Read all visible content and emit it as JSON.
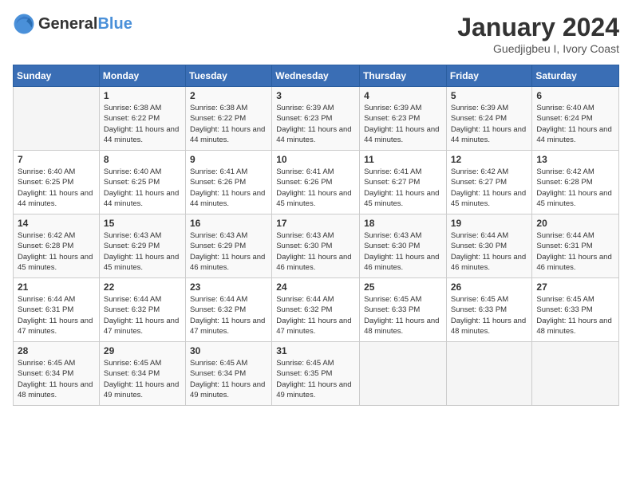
{
  "header": {
    "logo_general": "General",
    "logo_blue": "Blue",
    "month_year": "January 2024",
    "location": "Guedjigbeu I, Ivory Coast"
  },
  "weekdays": [
    "Sunday",
    "Monday",
    "Tuesday",
    "Wednesday",
    "Thursday",
    "Friday",
    "Saturday"
  ],
  "weeks": [
    [
      {
        "day": "",
        "sunrise": "",
        "sunset": "",
        "daylight": ""
      },
      {
        "day": "1",
        "sunrise": "Sunrise: 6:38 AM",
        "sunset": "Sunset: 6:22 PM",
        "daylight": "Daylight: 11 hours and 44 minutes."
      },
      {
        "day": "2",
        "sunrise": "Sunrise: 6:38 AM",
        "sunset": "Sunset: 6:22 PM",
        "daylight": "Daylight: 11 hours and 44 minutes."
      },
      {
        "day": "3",
        "sunrise": "Sunrise: 6:39 AM",
        "sunset": "Sunset: 6:23 PM",
        "daylight": "Daylight: 11 hours and 44 minutes."
      },
      {
        "day": "4",
        "sunrise": "Sunrise: 6:39 AM",
        "sunset": "Sunset: 6:23 PM",
        "daylight": "Daylight: 11 hours and 44 minutes."
      },
      {
        "day": "5",
        "sunrise": "Sunrise: 6:39 AM",
        "sunset": "Sunset: 6:24 PM",
        "daylight": "Daylight: 11 hours and 44 minutes."
      },
      {
        "day": "6",
        "sunrise": "Sunrise: 6:40 AM",
        "sunset": "Sunset: 6:24 PM",
        "daylight": "Daylight: 11 hours and 44 minutes."
      }
    ],
    [
      {
        "day": "7",
        "sunrise": "Sunrise: 6:40 AM",
        "sunset": "Sunset: 6:25 PM",
        "daylight": "Daylight: 11 hours and 44 minutes."
      },
      {
        "day": "8",
        "sunrise": "Sunrise: 6:40 AM",
        "sunset": "Sunset: 6:25 PM",
        "daylight": "Daylight: 11 hours and 44 minutes."
      },
      {
        "day": "9",
        "sunrise": "Sunrise: 6:41 AM",
        "sunset": "Sunset: 6:26 PM",
        "daylight": "Daylight: 11 hours and 44 minutes."
      },
      {
        "day": "10",
        "sunrise": "Sunrise: 6:41 AM",
        "sunset": "Sunset: 6:26 PM",
        "daylight": "Daylight: 11 hours and 45 minutes."
      },
      {
        "day": "11",
        "sunrise": "Sunrise: 6:41 AM",
        "sunset": "Sunset: 6:27 PM",
        "daylight": "Daylight: 11 hours and 45 minutes."
      },
      {
        "day": "12",
        "sunrise": "Sunrise: 6:42 AM",
        "sunset": "Sunset: 6:27 PM",
        "daylight": "Daylight: 11 hours and 45 minutes."
      },
      {
        "day": "13",
        "sunrise": "Sunrise: 6:42 AM",
        "sunset": "Sunset: 6:28 PM",
        "daylight": "Daylight: 11 hours and 45 minutes."
      }
    ],
    [
      {
        "day": "14",
        "sunrise": "Sunrise: 6:42 AM",
        "sunset": "Sunset: 6:28 PM",
        "daylight": "Daylight: 11 hours and 45 minutes."
      },
      {
        "day": "15",
        "sunrise": "Sunrise: 6:43 AM",
        "sunset": "Sunset: 6:29 PM",
        "daylight": "Daylight: 11 hours and 45 minutes."
      },
      {
        "day": "16",
        "sunrise": "Sunrise: 6:43 AM",
        "sunset": "Sunset: 6:29 PM",
        "daylight": "Daylight: 11 hours and 46 minutes."
      },
      {
        "day": "17",
        "sunrise": "Sunrise: 6:43 AM",
        "sunset": "Sunset: 6:30 PM",
        "daylight": "Daylight: 11 hours and 46 minutes."
      },
      {
        "day": "18",
        "sunrise": "Sunrise: 6:43 AM",
        "sunset": "Sunset: 6:30 PM",
        "daylight": "Daylight: 11 hours and 46 minutes."
      },
      {
        "day": "19",
        "sunrise": "Sunrise: 6:44 AM",
        "sunset": "Sunset: 6:30 PM",
        "daylight": "Daylight: 11 hours and 46 minutes."
      },
      {
        "day": "20",
        "sunrise": "Sunrise: 6:44 AM",
        "sunset": "Sunset: 6:31 PM",
        "daylight": "Daylight: 11 hours and 46 minutes."
      }
    ],
    [
      {
        "day": "21",
        "sunrise": "Sunrise: 6:44 AM",
        "sunset": "Sunset: 6:31 PM",
        "daylight": "Daylight: 11 hours and 47 minutes."
      },
      {
        "day": "22",
        "sunrise": "Sunrise: 6:44 AM",
        "sunset": "Sunset: 6:32 PM",
        "daylight": "Daylight: 11 hours and 47 minutes."
      },
      {
        "day": "23",
        "sunrise": "Sunrise: 6:44 AM",
        "sunset": "Sunset: 6:32 PM",
        "daylight": "Daylight: 11 hours and 47 minutes."
      },
      {
        "day": "24",
        "sunrise": "Sunrise: 6:44 AM",
        "sunset": "Sunset: 6:32 PM",
        "daylight": "Daylight: 11 hours and 47 minutes."
      },
      {
        "day": "25",
        "sunrise": "Sunrise: 6:45 AM",
        "sunset": "Sunset: 6:33 PM",
        "daylight": "Daylight: 11 hours and 48 minutes."
      },
      {
        "day": "26",
        "sunrise": "Sunrise: 6:45 AM",
        "sunset": "Sunset: 6:33 PM",
        "daylight": "Daylight: 11 hours and 48 minutes."
      },
      {
        "day": "27",
        "sunrise": "Sunrise: 6:45 AM",
        "sunset": "Sunset: 6:33 PM",
        "daylight": "Daylight: 11 hours and 48 minutes."
      }
    ],
    [
      {
        "day": "28",
        "sunrise": "Sunrise: 6:45 AM",
        "sunset": "Sunset: 6:34 PM",
        "daylight": "Daylight: 11 hours and 48 minutes."
      },
      {
        "day": "29",
        "sunrise": "Sunrise: 6:45 AM",
        "sunset": "Sunset: 6:34 PM",
        "daylight": "Daylight: 11 hours and 49 minutes."
      },
      {
        "day": "30",
        "sunrise": "Sunrise: 6:45 AM",
        "sunset": "Sunset: 6:34 PM",
        "daylight": "Daylight: 11 hours and 49 minutes."
      },
      {
        "day": "31",
        "sunrise": "Sunrise: 6:45 AM",
        "sunset": "Sunset: 6:35 PM",
        "daylight": "Daylight: 11 hours and 49 minutes."
      },
      {
        "day": "",
        "sunrise": "",
        "sunset": "",
        "daylight": ""
      },
      {
        "day": "",
        "sunrise": "",
        "sunset": "",
        "daylight": ""
      },
      {
        "day": "",
        "sunrise": "",
        "sunset": "",
        "daylight": ""
      }
    ]
  ]
}
